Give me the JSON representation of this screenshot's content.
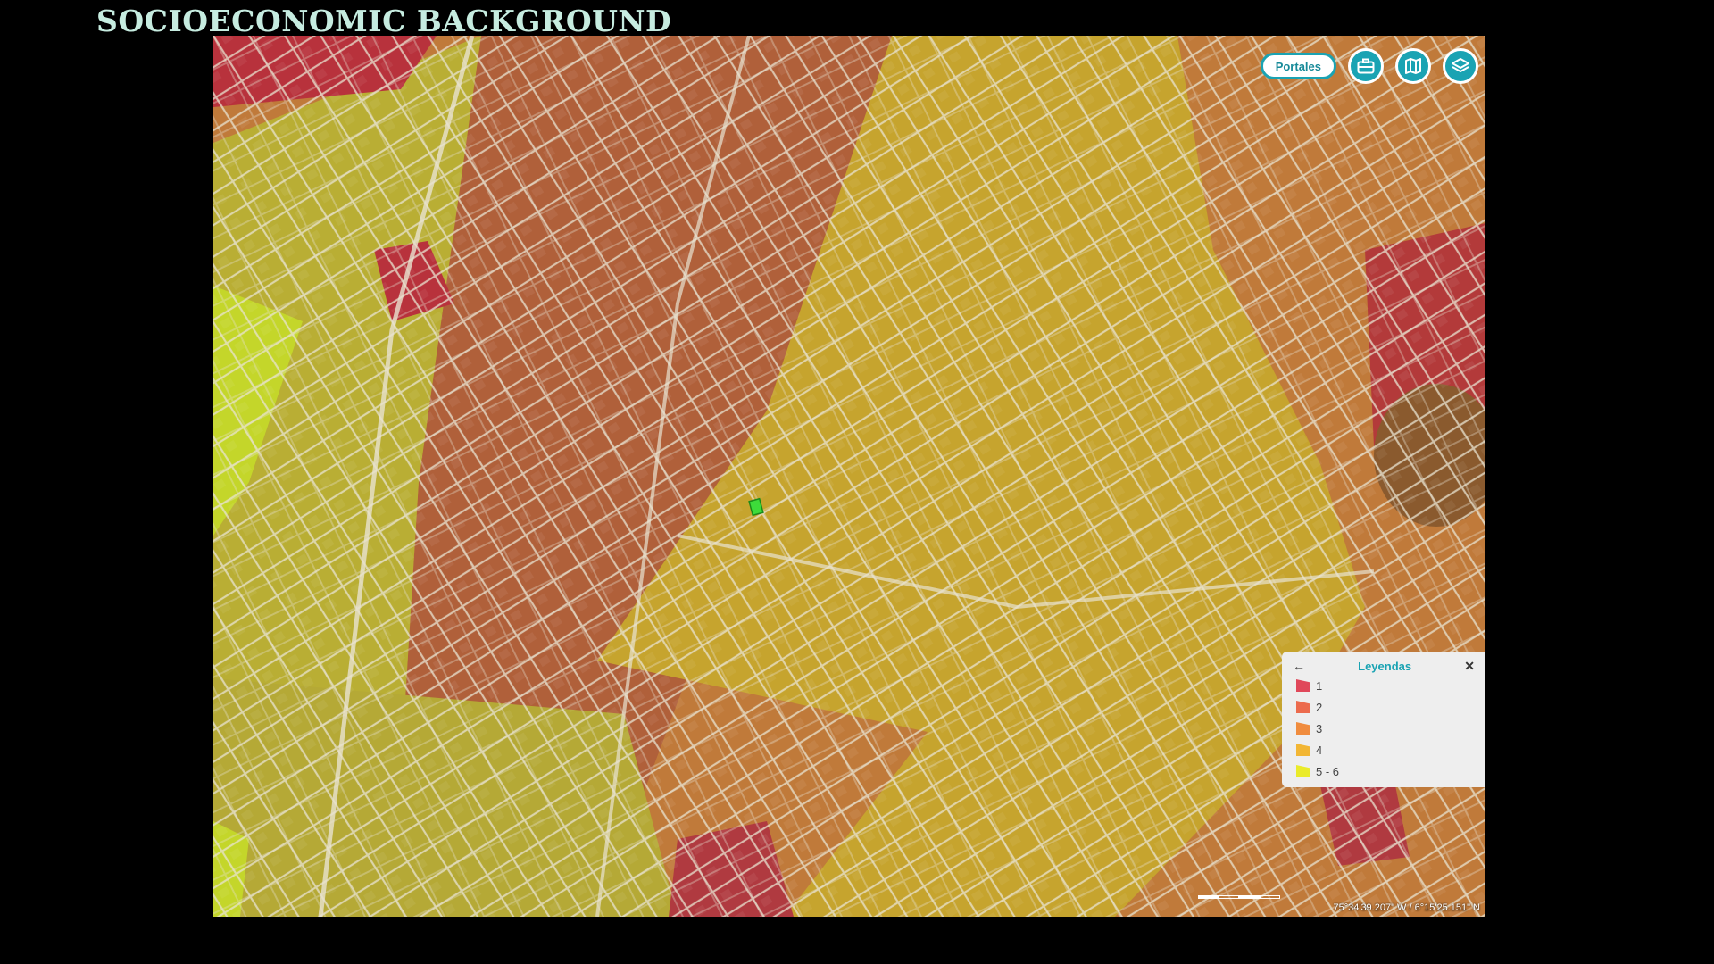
{
  "title": "SOCIOECONOMIC BACKGROUND",
  "map": {
    "controls": {
      "portales_label": "Portales",
      "briefcase_icon": "briefcase-icon",
      "map_icon": "map-icon",
      "layers_icon": "layers-icon"
    },
    "legend": {
      "title": "Leyendas",
      "back_icon": "arrow-left-icon",
      "close_icon": "close-icon",
      "items": [
        {
          "label": "1",
          "color": "#e0485a"
        },
        {
          "label": "2",
          "color": "#ec6b4d"
        },
        {
          "label": "3",
          "color": "#f08c3e"
        },
        {
          "label": "4",
          "color": "#f2b634"
        },
        {
          "label": "5 - 6",
          "color": "#eaeb2a"
        }
      ]
    },
    "coordinates": "75°34'39.207\" W / 6°15'25.151\" N",
    "zone_colors": {
      "stratum_1": "#b8323c",
      "stratum_2": "#b96a38",
      "stratum_3": "#c8843a",
      "stratum_4": "#c4a82c",
      "stratum_5_6": "#b8c820",
      "streets": "#e8e2d0",
      "highlight": "#3ddc3a"
    }
  }
}
